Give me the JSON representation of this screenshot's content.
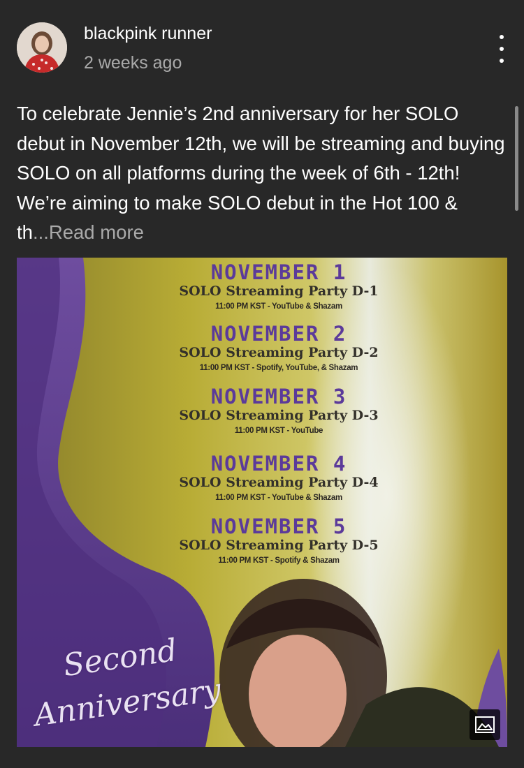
{
  "post": {
    "author": "blackpink runner",
    "time": "2 weeks ago",
    "text": "To celebrate Jennie’s 2nd anniversary for her SOLO debut in November 12th, we will be streaming and buying SOLO on all platforms during the week of 6th - 12th! We’re aiming to make SOLO debut in the Hot 100 & th",
    "read_more": "...Read more"
  },
  "poster": {
    "events": [
      {
        "month": "NOVEMBER 1",
        "party": "SOLO Streaming Party D-1",
        "detail": "11:00 PM KST - YouTube & Shazam"
      },
      {
        "month": "NOVEMBER 2",
        "party": "SOLO Streaming Party D-2",
        "detail": "11:00 PM KST - Spotify, YouTube, & Shazam"
      },
      {
        "month": "NOVEMBER 3",
        "party": "SOLO Streaming Party D-3",
        "detail": "11:00 PM KST - YouTube"
      },
      {
        "month": "NOVEMBER 4",
        "party": "SOLO Streaming Party D-4",
        "detail": "11:00 PM KST - YouTube & Shazam"
      },
      {
        "month": "NOVEMBER 5",
        "party": "SOLO Streaming Party D-5",
        "detail": "11:00 PM KST - Spotify & Shazam"
      }
    ],
    "script_line1": "Second",
    "script_line2": "Anniversary"
  },
  "icons": {
    "menu": "more-vert-icon",
    "image_badge": "image-icon"
  },
  "colors": {
    "background": "#282828",
    "text": "#ffffff",
    "secondary": "#aaaaaa",
    "poster_purple": "#5b3a9a"
  }
}
